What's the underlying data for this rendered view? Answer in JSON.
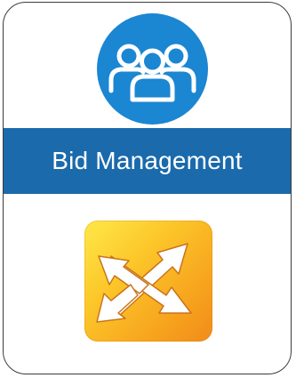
{
  "banner": {
    "title": "Bid Management"
  },
  "icons": {
    "team": "people-group-icon",
    "app": "cross-arrows-icon"
  },
  "colors": {
    "badge_blue": "#1b86d2",
    "banner_blue": "#1a6aac",
    "tile_yellow": "#ffe84a",
    "tile_orange": "#f08c1c",
    "border": "#3c3c3c"
  }
}
